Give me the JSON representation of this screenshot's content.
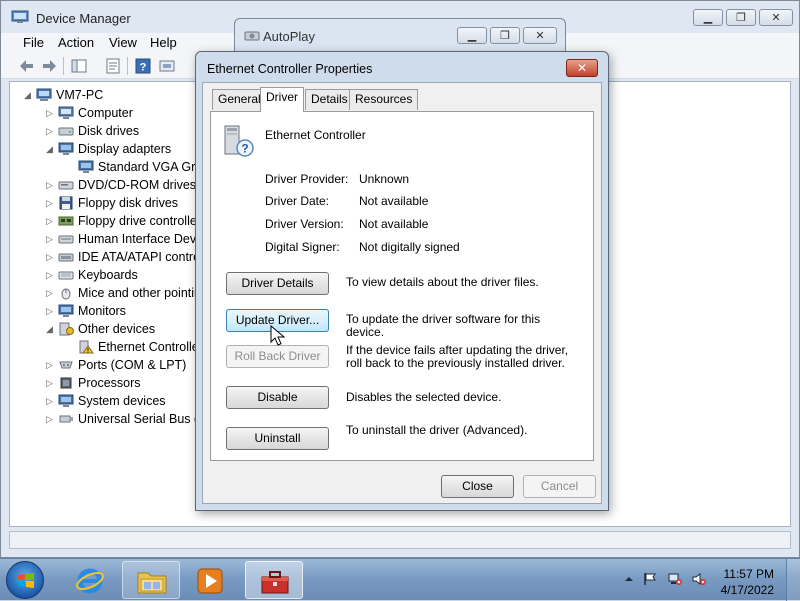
{
  "device_manager": {
    "title": "Device Manager",
    "menu": [
      "File",
      "Action",
      "View",
      "Help"
    ],
    "tree": [
      {
        "label": "VM7-PC",
        "icon": "computer-root-icon",
        "expanded": true
      },
      {
        "label": "Computer",
        "icon": "computer-icon"
      },
      {
        "label": "Disk drives",
        "icon": "disk-drive-icon"
      },
      {
        "label": "Display adapters",
        "icon": "display-adapter-icon",
        "expanded": true
      },
      {
        "label": "Standard VGA Grap",
        "icon": "monitor-icon",
        "child": true
      },
      {
        "label": "DVD/CD-ROM drives",
        "icon": "dvd-drive-icon"
      },
      {
        "label": "Floppy disk drives",
        "icon": "floppy-icon"
      },
      {
        "label": "Floppy drive controller",
        "icon": "controller-icon"
      },
      {
        "label": "Human Interface Devic",
        "icon": "hid-icon"
      },
      {
        "label": "IDE ATA/ATAPI contro",
        "icon": "ide-icon"
      },
      {
        "label": "Keyboards",
        "icon": "keyboard-icon"
      },
      {
        "label": "Mice and other pointin",
        "icon": "mouse-icon"
      },
      {
        "label": "Monitors",
        "icon": "monitor-icon"
      },
      {
        "label": "Other devices",
        "icon": "other-devices-icon",
        "expanded": true
      },
      {
        "label": "Ethernet Controller",
        "icon": "unknown-device-icon",
        "child": true
      },
      {
        "label": "Ports (COM & LPT)",
        "icon": "port-icon"
      },
      {
        "label": "Processors",
        "icon": "processor-icon"
      },
      {
        "label": "System devices",
        "icon": "system-icon"
      },
      {
        "label": "Universal Serial Bus co",
        "icon": "usb-icon"
      }
    ]
  },
  "autoplay": {
    "title": "AutoPlay"
  },
  "dialog": {
    "title": "Ethernet Controller Properties",
    "close_glyph": "✕",
    "tabs": [
      "General",
      "Driver",
      "Details",
      "Resources"
    ],
    "active_tab": "Driver",
    "device_name": "Ethernet Controller",
    "info": [
      {
        "label": "Driver Provider:",
        "value": "Unknown"
      },
      {
        "label": "Driver Date:",
        "value": "Not available"
      },
      {
        "label": "Driver Version:",
        "value": "Not available"
      },
      {
        "label": "Digital Signer:",
        "value": "Not digitally signed"
      }
    ],
    "actions": [
      {
        "button": "Driver Details",
        "desc": "To view details about the driver files."
      },
      {
        "button": "Update Driver...",
        "desc": "To update the driver software for this device."
      },
      {
        "button": "Roll Back Driver",
        "desc": "If the device fails after updating the driver, roll back to the previously installed driver."
      },
      {
        "button": "Disable",
        "desc": "Disables the selected device."
      },
      {
        "button": "Uninstall",
        "desc": "To uninstall the driver (Advanced)."
      }
    ],
    "close_button": "Close",
    "cancel_button": "Cancel"
  },
  "taskbar": {
    "time": "11:57 PM",
    "date": "4/17/2022",
    "apps": [
      "internet-explorer-icon",
      "windows-explorer-icon",
      "media-player-icon",
      "device-manager-toolbox-icon"
    ]
  }
}
